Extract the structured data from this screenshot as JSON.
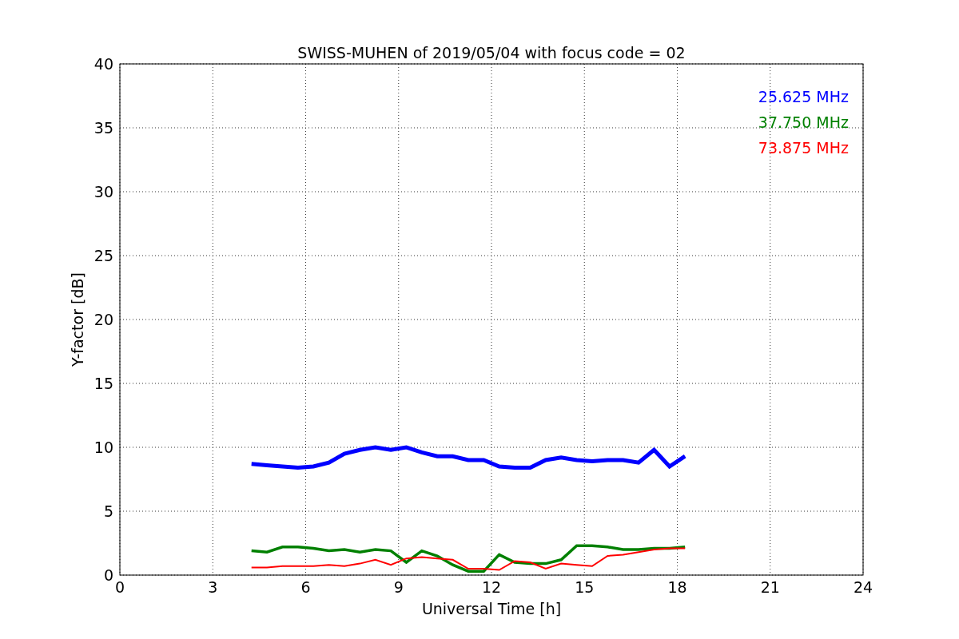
{
  "chart_data": {
    "type": "line",
    "title": "SWISS-MUHEN of 2019/05/04 with focus code = 02",
    "xlabel": "Universal Time [h]",
    "ylabel": "Y-factor [dB]",
    "x": [
      4.25,
      4.75,
      5.25,
      5.75,
      6.25,
      6.75,
      7.25,
      7.75,
      8.25,
      8.75,
      9.25,
      9.75,
      10.25,
      10.75,
      11.25,
      11.75,
      12.25,
      12.75,
      13.25,
      13.75,
      14.25,
      14.75,
      15.25,
      15.75,
      16.25,
      16.75,
      17.25,
      17.75,
      18.25
    ],
    "series": [
      {
        "name": "25.625 MHz",
        "color": "#0000ff",
        "values": [
          8.7,
          8.6,
          8.5,
          8.4,
          8.5,
          8.8,
          9.5,
          9.8,
          10.0,
          9.8,
          10.0,
          9.6,
          9.3,
          9.3,
          9.0,
          9.0,
          8.5,
          8.4,
          8.4,
          9.0,
          9.2,
          9.0,
          8.9,
          9.0,
          9.0,
          8.8,
          9.8,
          8.5,
          9.3
        ]
      },
      {
        "name": "37.750 MHz",
        "color": "#008000",
        "values": [
          1.9,
          1.8,
          2.2,
          2.2,
          2.1,
          1.9,
          2.0,
          1.8,
          2.0,
          1.9,
          1.0,
          1.9,
          1.5,
          0.8,
          0.3,
          0.3,
          1.6,
          1.0,
          0.9,
          0.9,
          1.2,
          2.3,
          2.3,
          2.2,
          2.0,
          2.0,
          2.1,
          2.1,
          2.2
        ]
      },
      {
        "name": "73.875 MHz",
        "color": "#ff0000",
        "values": [
          0.6,
          0.6,
          0.7,
          0.7,
          0.7,
          0.8,
          0.7,
          0.9,
          1.2,
          0.8,
          1.3,
          1.4,
          1.3,
          1.2,
          0.5,
          0.5,
          0.4,
          1.1,
          1.0,
          0.5,
          0.9,
          0.8,
          0.7,
          1.5,
          1.6,
          1.8,
          2.0,
          2.1,
          2.1
        ]
      }
    ],
    "grid": true,
    "xlim": [
      0,
      24
    ],
    "ylim": [
      0,
      40
    ],
    "xticks": [
      0,
      3,
      6,
      9,
      12,
      15,
      18,
      21,
      24
    ],
    "yticks": [
      0,
      5,
      10,
      15,
      20,
      25,
      30,
      35,
      40
    ]
  }
}
